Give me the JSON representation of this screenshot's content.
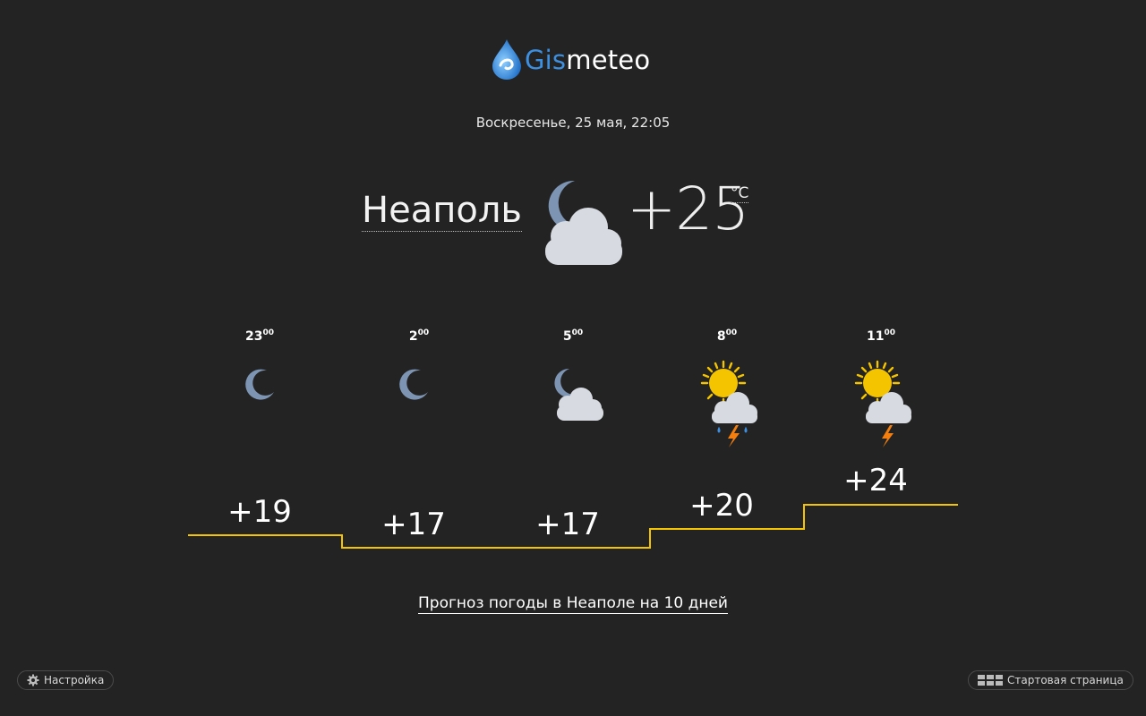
{
  "brand": {
    "gis": "Gis",
    "meteo": "meteo"
  },
  "datetime": "Воскресенье, 25 мая, 22:05",
  "current": {
    "city": "Неаполь",
    "temperature": "+25",
    "unit": "°C",
    "condition_icon": "moon-cloud-icon"
  },
  "hourly": [
    {
      "hour": "23",
      "minutes": "00",
      "temp": "+19",
      "icon": "moon-icon"
    },
    {
      "hour": "2",
      "minutes": "00",
      "temp": "+17",
      "icon": "moon-icon"
    },
    {
      "hour": "5",
      "minutes": "00",
      "temp": "+17",
      "icon": "moon-cloud-icon"
    },
    {
      "hour": "8",
      "minutes": "00",
      "temp": "+20",
      "icon": "sun-cloud-thunderstorm-rain-icon"
    },
    {
      "hour": "11",
      "minutes": "00",
      "temp": "+24",
      "icon": "sun-cloud-thunder-icon"
    }
  ],
  "forecast_link": "Прогноз погоды в Неаполе на 10 дней",
  "footer": {
    "settings_label": "Настройка",
    "start_page_label": "Стартовая страница"
  },
  "colors": {
    "background": "#232323",
    "temp_line": "#f5c400",
    "brand_blue": "#3d8fe0"
  }
}
